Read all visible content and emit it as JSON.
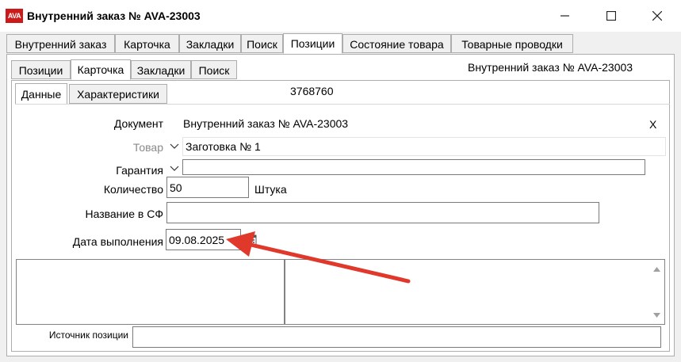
{
  "window": {
    "logo": "AVA",
    "title": "Внутренний заказ № AVA-23003",
    "minimize_icon": "minimize-icon",
    "maximize_icon": "maximize-icon",
    "close_icon": "close-icon"
  },
  "outer_tabs": [
    {
      "label": "Внутренний заказ",
      "active": false
    },
    {
      "label": "Карточка",
      "active": false
    },
    {
      "label": "Закладки",
      "active": false
    },
    {
      "label": "Поиск",
      "active": false
    },
    {
      "label": "Позиции",
      "active": true
    },
    {
      "label": "Состояние товара",
      "active": false
    },
    {
      "label": "Товарные проводки",
      "active": false
    }
  ],
  "inner_tabs": [
    {
      "label": "Позиции",
      "active": false
    },
    {
      "label": "Карточка",
      "active": true
    },
    {
      "label": "Закладки",
      "active": false
    },
    {
      "label": "Поиск",
      "active": false
    }
  ],
  "inner_header_title": "Внутренний заказ № AVA-23003",
  "sub_tabs": [
    {
      "label": "Данные",
      "active": true
    },
    {
      "label": "Характеристики",
      "active": false
    }
  ],
  "record_id": "3768760",
  "form": {
    "document_label": "Документ",
    "document_value": "Внутренний заказ № AVA-23003",
    "document_clear": "X",
    "product_label": "Товар",
    "product_value": "Заготовка № 1",
    "warranty_label": "Гарантия",
    "warranty_value": "",
    "quantity_label": "Количество",
    "quantity_value": "50",
    "unit": "Штука",
    "invoice_name_label": "Название в СФ",
    "invoice_name_value": "",
    "completion_date_label": "Дата выполнения",
    "completion_date_value": "09.08.2025",
    "source_label": "Источник позиции",
    "source_value": ""
  },
  "colors": {
    "arrow": "#e0392b",
    "logo_bg": "#cc1a1a"
  }
}
